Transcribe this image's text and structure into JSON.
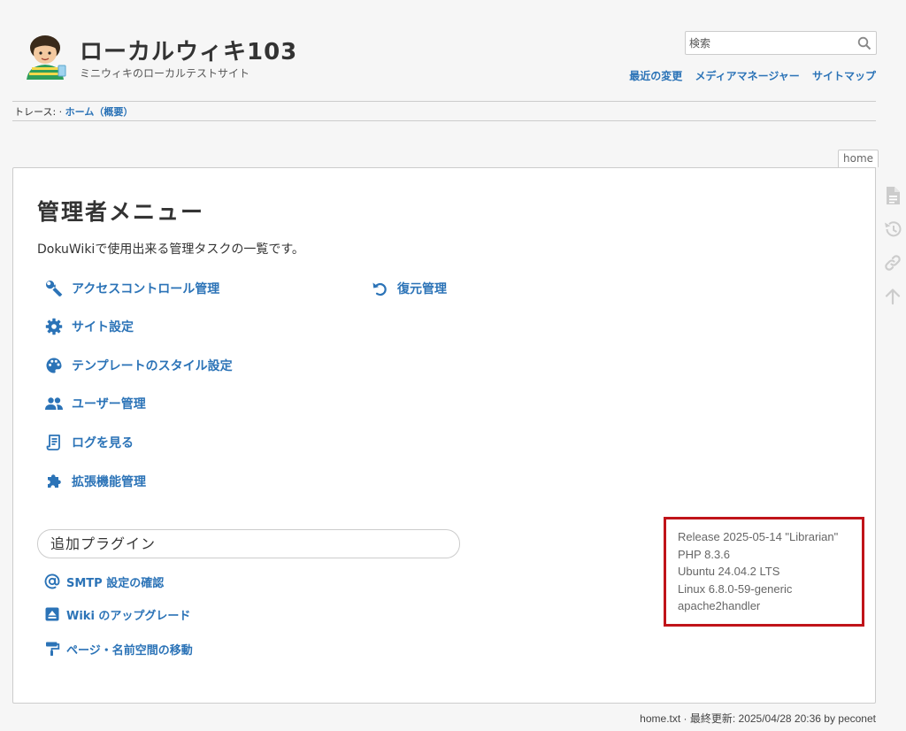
{
  "header": {
    "title": "ローカルウィキ103",
    "tagline": "ミニウィキのローカルテストサイト",
    "search": {
      "placeholder": "検索"
    },
    "user_tools": [
      "最近の変更",
      "メディアマネージャー",
      "サイトマップ"
    ]
  },
  "breadcrumbs": {
    "label": "トレース:",
    "separator": "·",
    "trail": [
      {
        "label": "ホーム（概要）"
      }
    ]
  },
  "page_id": "home",
  "page": {
    "title": "管理者メニュー",
    "intro": "DokuWikiで使用出来る管理タスクの一覧です。",
    "admin_items": [
      {
        "label": "アクセスコントロール管理",
        "icon": "wrench-icon"
      },
      {
        "label": "サイト設定",
        "icon": "gear-icon"
      },
      {
        "label": "テンプレートのスタイル設定",
        "icon": "palette-icon"
      },
      {
        "label": "ユーザー管理",
        "icon": "users-icon"
      },
      {
        "label": "ログを見る",
        "icon": "log-icon"
      },
      {
        "label": "拡張機能管理",
        "icon": "puzzle-icon"
      }
    ],
    "admin_items_right": [
      {
        "label": "復元管理",
        "icon": "undo-icon"
      }
    ],
    "additional_heading": "追加プラグイン",
    "additional_items": [
      {
        "label": "SMTP 設定の確認",
        "icon": "at-icon"
      },
      {
        "label": "Wiki のアップグレード",
        "icon": "upgrade-icon"
      },
      {
        "label": "ページ・名前空間の移動",
        "icon": "paint-roller-icon"
      }
    ],
    "version_info": [
      "Release 2025-05-14 \"Librarian\"",
      "PHP 8.3.6",
      "Ubuntu 24.04.2 LTS",
      "Linux 6.8.0-59-generic",
      "apache2handler"
    ]
  },
  "page_tools": [
    "show-page-icon",
    "old-revisions-icon",
    "backlinks-icon",
    "back-to-top-icon"
  ],
  "doc_info": "home.txt · 最終更新: 2025/04/28 20:36 by peconet",
  "colors": {
    "link": "#2b73b7",
    "highlight_border": "#c0141a",
    "tool_icon": "#cccccc"
  }
}
